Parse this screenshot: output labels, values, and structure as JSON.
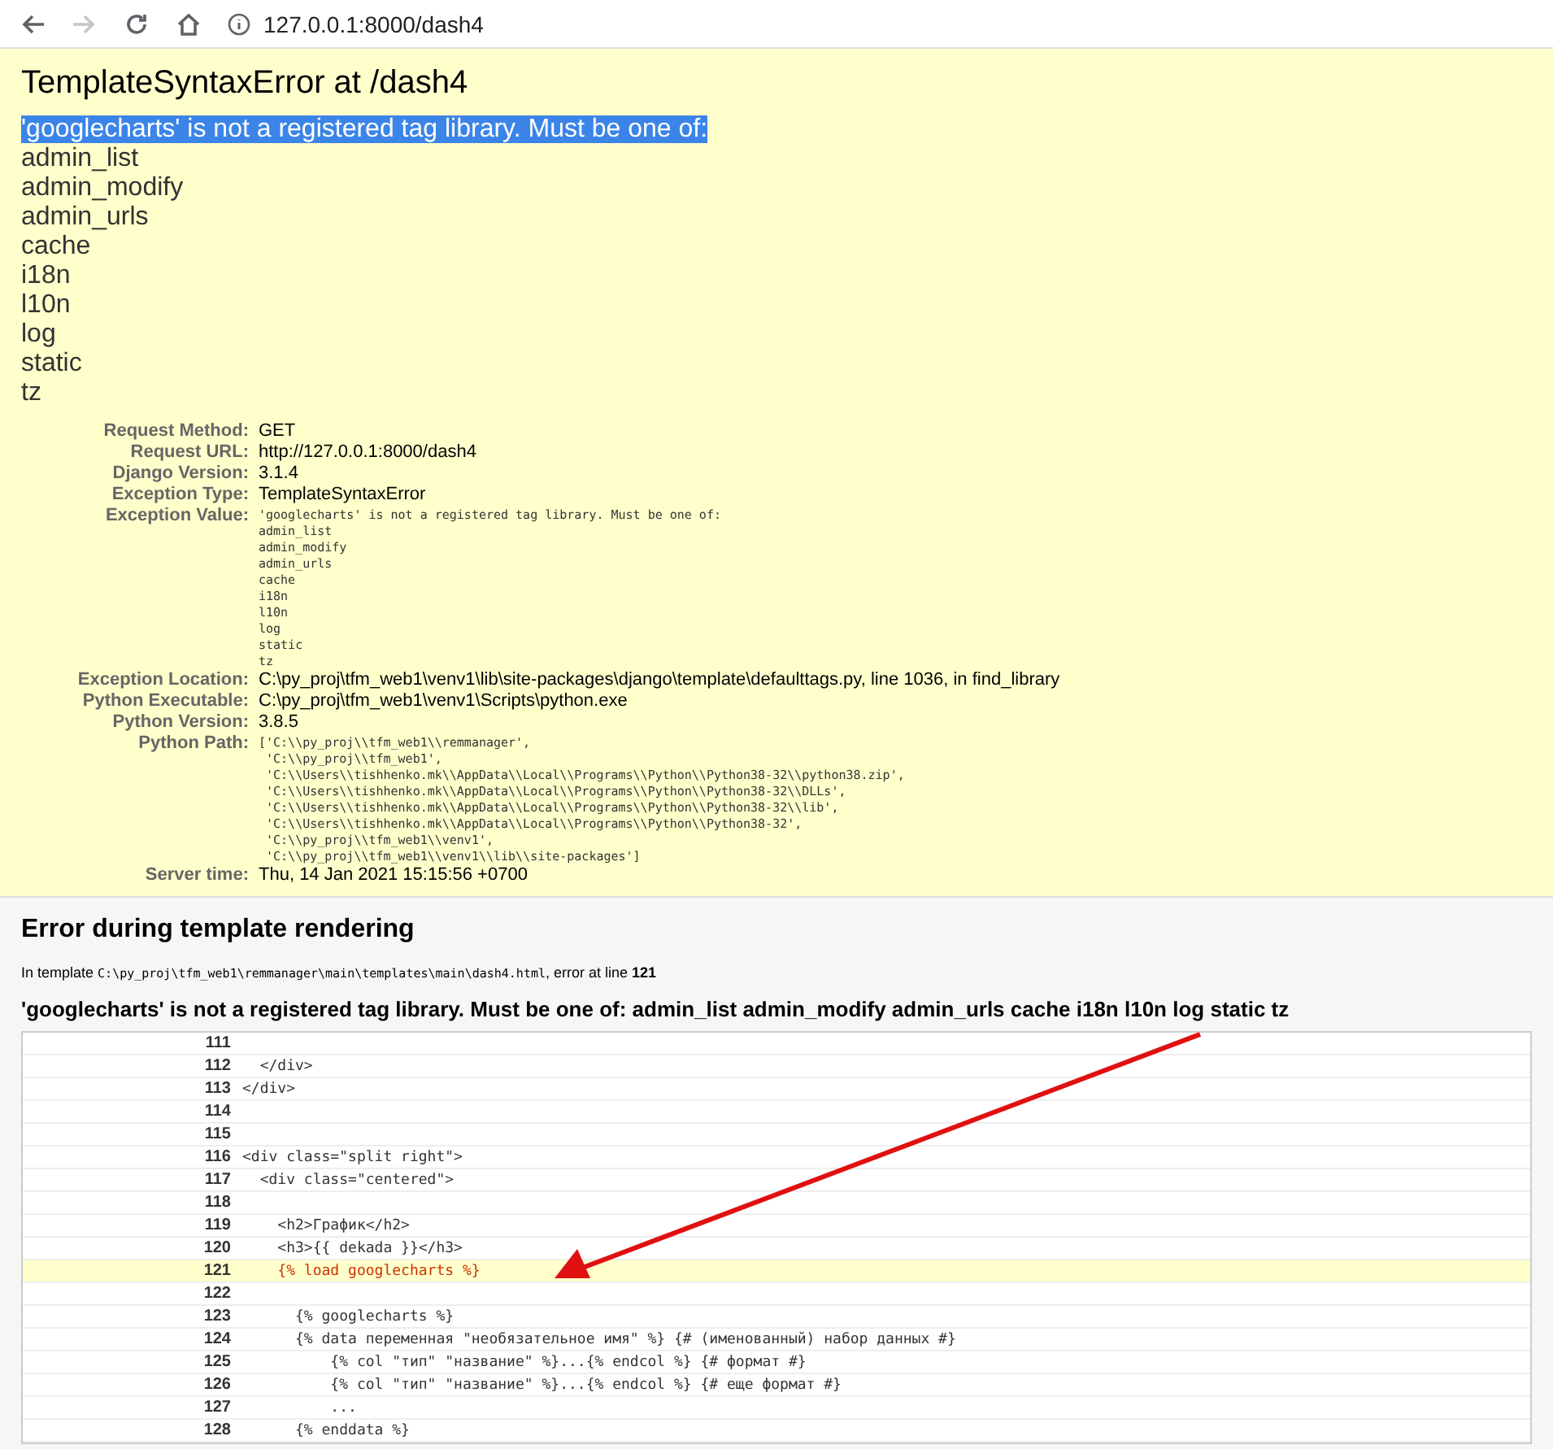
{
  "browser": {
    "nav_buttons": [
      {
        "kind": "back",
        "disabled": false
      },
      {
        "kind": "forward",
        "disabled": true
      },
      {
        "kind": "reload",
        "disabled": false
      },
      {
        "kind": "home",
        "disabled": false
      }
    ],
    "url": "127.0.0.1:8000/dash4"
  },
  "summary": {
    "title": "TemplateSyntaxError at /dash4",
    "message": {
      "text": "'googlecharts' is not a registered tag library. Must be one of:",
      "highlighted": true
    },
    "libraries": [
      "admin_list",
      "admin_modify",
      "admin_urls",
      "cache",
      "i18n",
      "l10n",
      "log",
      "static",
      "tz"
    ],
    "meta": [
      {
        "label": "Request Method:",
        "value": "GET",
        "kind": "text"
      },
      {
        "label": "Request URL:",
        "value": "http://127.0.0.1:8000/dash4",
        "kind": "text"
      },
      {
        "label": "Django Version:",
        "value": "3.1.4",
        "kind": "text"
      },
      {
        "label": "Exception Type:",
        "value": "TemplateSyntaxError",
        "kind": "text"
      },
      {
        "label": "Exception Value:",
        "value": "'googlecharts' is not a registered tag library. Must be one of:\nadmin_list\nadmin_modify\nadmin_urls\ncache\ni18n\nl10n\nlog\nstatic\ntz",
        "kind": "code"
      },
      {
        "label": "Exception Location:",
        "value": "C:\\py_proj\\tfm_web1\\venv1\\lib\\site-packages\\django\\template\\defaulttags.py, line 1036, in find_library",
        "kind": "text"
      },
      {
        "label": "Python Executable:",
        "value": "C:\\py_proj\\tfm_web1\\venv1\\Scripts\\python.exe",
        "kind": "text"
      },
      {
        "label": "Python Version:",
        "value": "3.8.5",
        "kind": "text"
      },
      {
        "label": "Python Path:",
        "value": "['C:\\\\py_proj\\\\tfm_web1\\\\remmanager',\n 'C:\\\\py_proj\\\\tfm_web1',\n 'C:\\\\Users\\\\tishhenko.mk\\\\AppData\\\\Local\\\\Programs\\\\Python\\\\Python38-32\\\\python38.zip',\n 'C:\\\\Users\\\\tishhenko.mk\\\\AppData\\\\Local\\\\Programs\\\\Python\\\\Python38-32\\\\DLLs',\n 'C:\\\\Users\\\\tishhenko.mk\\\\AppData\\\\Local\\\\Programs\\\\Python\\\\Python38-32\\\\lib',\n 'C:\\\\Users\\\\tishhenko.mk\\\\AppData\\\\Local\\\\Programs\\\\Python\\\\Python38-32',\n 'C:\\\\py_proj\\\\tfm_web1\\\\venv1',\n 'C:\\\\py_proj\\\\tfm_web1\\\\venv1\\\\lib\\\\site-packages']",
        "kind": "code"
      },
      {
        "label": "Server time:",
        "value": "Thu, 14 Jan 2021 15:15:56 +0700",
        "kind": "text"
      }
    ]
  },
  "template": {
    "heading": "Error during template rendering",
    "location_prefix": "In template",
    "path": "C:\\py_proj\\tfm_web1\\remmanager\\main\\templates\\main\\dash4.html",
    "error_text": ", error at line",
    "error_line": "121",
    "message": "'googlecharts' is not a registered tag library. Must be one of: admin_list admin_modify admin_urls cache i18n l10n log static tz",
    "lines": [
      {
        "number": "111",
        "highlighted": false
      },
      {
        "number": "112",
        "code": "  </div>",
        "highlighted": false
      },
      {
        "number": "113",
        "code": "</div>",
        "highlighted": false
      },
      {
        "number": "114",
        "highlighted": false
      },
      {
        "number": "115",
        "highlighted": false
      },
      {
        "number": "116",
        "code": "<div class=\"split right\">",
        "highlighted": false
      },
      {
        "number": "117",
        "code": "  <div class=\"centered\">",
        "highlighted": false
      },
      {
        "number": "118",
        "highlighted": false
      },
      {
        "number": "119",
        "code": "    <h2>График</h2>",
        "highlighted": false
      },
      {
        "number": "120",
        "code": "    <h3>{{ dekada }}</h3>",
        "highlighted": false
      },
      {
        "number": "121",
        "code": "    {% load googlecharts %}",
        "highlighted": true
      },
      {
        "number": "122",
        "highlighted": false
      },
      {
        "number": "123",
        "code": "      {% googlecharts %}",
        "highlighted": false
      },
      {
        "number": "124",
        "code": "      {% data переменная \"необязательное имя\" %} {# (именованный) набор данных #}",
        "highlighted": false
      },
      {
        "number": "125",
        "code": "          {% col \"тип\" \"название\" %}...{% endcol %} {# формат #}",
        "highlighted": false
      },
      {
        "number": "126",
        "code": "          {% col \"тип\" \"название\" %}...{% endcol %} {# еще формат #}",
        "highlighted": false
      },
      {
        "number": "127",
        "code": "          ...",
        "highlighted": false
      },
      {
        "number": "128",
        "code": "      {% enddata %}",
        "highlighted": false
      }
    ]
  }
}
